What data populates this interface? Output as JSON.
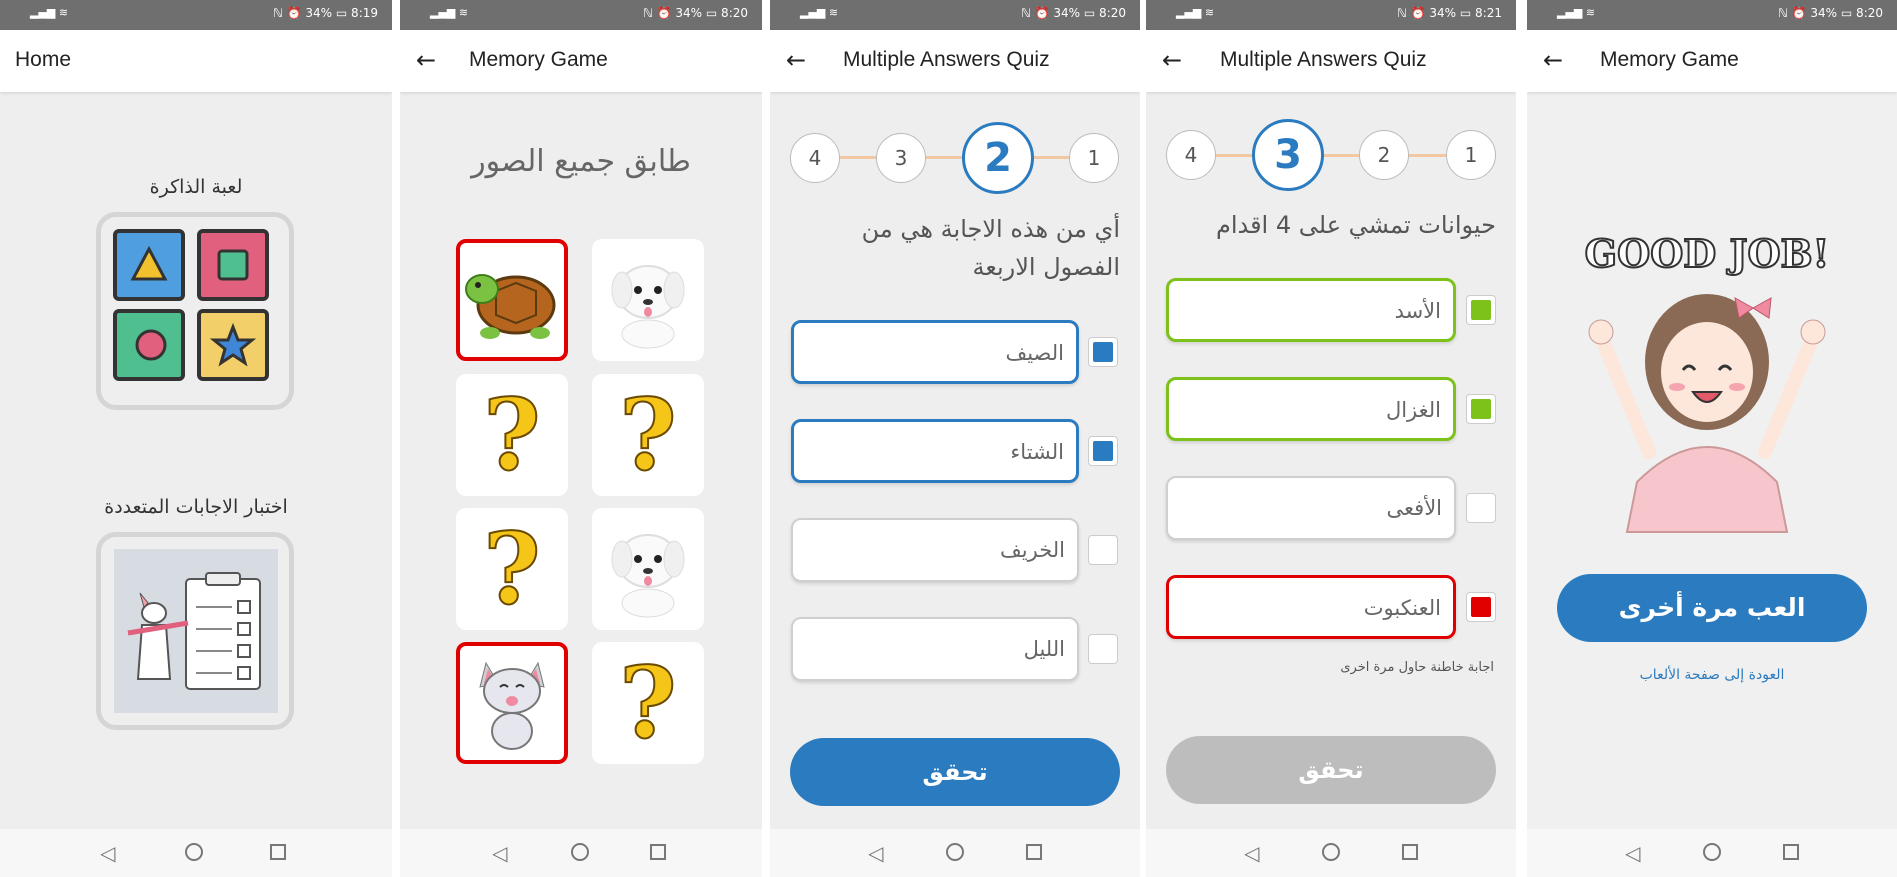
{
  "colors": {
    "primary": "#2a7bbf",
    "selected_red": "#e00000",
    "correct_green": "#7cc21a",
    "disabled_button": "#bdbdbd",
    "status_bar": "#6f6f6f"
  },
  "screens": [
    {
      "status": {
        "right": "ℕ ⏰ 34% ▭ 8:19"
      },
      "appbar": {
        "title": "Home"
      },
      "items": [
        {
          "label": "لعبة الذاكرة",
          "icon": "shapes-grid-icon"
        },
        {
          "label": "اختبار الاجابات المتعددة",
          "icon": "clipboard-checklist-icon"
        }
      ]
    },
    {
      "status": {
        "right": "ℕ ⏰ 34% ▭ 8:20"
      },
      "appbar": {
        "title": "Memory Game"
      },
      "heading": "طابق جميع الصور",
      "cards": [
        {
          "face": "turtle",
          "selected": true
        },
        {
          "face": "puppy",
          "selected": false
        },
        {
          "face": "question",
          "selected": false
        },
        {
          "face": "question",
          "selected": false
        },
        {
          "face": "question",
          "selected": false
        },
        {
          "face": "puppy",
          "selected": false
        },
        {
          "face": "kitten",
          "selected": true
        },
        {
          "face": "question",
          "selected": false
        }
      ]
    },
    {
      "status": {
        "right": "ℕ ⏰ 34% ▭ 8:20"
      },
      "appbar": {
        "title": "Multiple Answers Quiz"
      },
      "steps": [
        "4",
        "3",
        "2",
        "1"
      ],
      "active_step": "2",
      "question": "أي من هذه الاجابة هي من الفصول الاربعة",
      "answers": [
        {
          "text": "الصيف",
          "state": "selected"
        },
        {
          "text": "الشتاء",
          "state": "selected"
        },
        {
          "text": "الخريف",
          "state": "none"
        },
        {
          "text": "الليل",
          "state": "none"
        }
      ],
      "button": "تحقق"
    },
    {
      "status": {
        "right": "ℕ ⏰ 34% ▭ 8:21"
      },
      "appbar": {
        "title": "Multiple Answers Quiz"
      },
      "steps": [
        "4",
        "3",
        "2",
        "1"
      ],
      "active_step": "3",
      "question": "حيوانات تمشي على 4 اقدام",
      "answers": [
        {
          "text": "الأسد",
          "state": "correct"
        },
        {
          "text": "الغزال",
          "state": "correct"
        },
        {
          "text": "الأفعى",
          "state": "none"
        },
        {
          "text": "العنكبوت",
          "state": "wrong"
        }
      ],
      "error": "اجابة خاطنة حاول مرة اخرى",
      "button": "تحقق"
    },
    {
      "status": {
        "right": "ℕ ⏰ 34% ▭ 8:20"
      },
      "appbar": {
        "title": "Memory Game"
      },
      "sticker_text": "GOOD JOB!",
      "button": "العب مرة أخرى",
      "link": "العودة إلى صفحة الألعاب"
    }
  ]
}
